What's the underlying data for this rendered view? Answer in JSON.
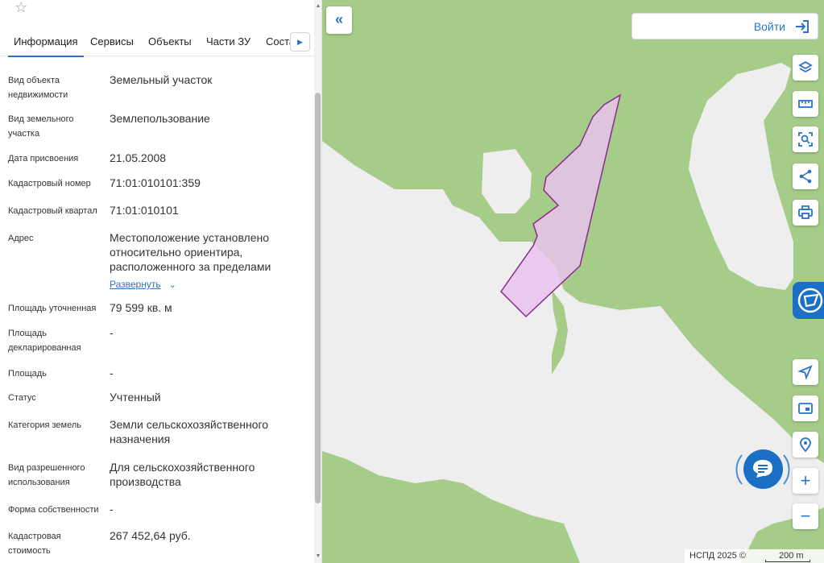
{
  "panel": {
    "favorite_icon": "star-icon",
    "tabs": [
      {
        "label": "Информация",
        "active": true
      },
      {
        "label": "Сервисы",
        "active": false
      },
      {
        "label": "Объекты",
        "active": false
      },
      {
        "label": "Части ЗУ",
        "active": false
      },
      {
        "label": "Соста",
        "active": false
      }
    ],
    "tab_next_icon": "chevron-right-icon",
    "rows": [
      {
        "label": "Вид объекта недвижимости",
        "value": "Земельный участок"
      },
      {
        "label": "Вид земельного участка",
        "value": "Землепользование"
      },
      {
        "label": "Дата присвоения",
        "value": "21.05.2008"
      },
      {
        "label": "Кадастровый номер",
        "value": "71:01:010101:359"
      },
      {
        "label": "Кадастровый квартал",
        "value": "71:01:010101"
      },
      {
        "label": "Адрес",
        "value": "Местоположение установлено относительно ориентира, расположенного за пределами",
        "expand_label": "Развернуть"
      },
      {
        "label": "Площадь уточненная",
        "value": "79 599 кв. м"
      },
      {
        "label": "Площадь декларированная",
        "value": "-"
      },
      {
        "label": "Площадь",
        "value": "-"
      },
      {
        "label": "Статус",
        "value": "Учтенный"
      },
      {
        "label": "Категория земель",
        "value": "Земли сельскохозяйственного назначения"
      },
      {
        "label": "Вид разрешенного использования",
        "value": "Для сельскохозяйственного производства"
      },
      {
        "label": "Форма собственности",
        "value": "-"
      },
      {
        "label": "Кадастровая стоимость",
        "value": "267 452,64 руб."
      }
    ]
  },
  "map": {
    "collapse_icon": "double-chevron-left-icon",
    "login_label": "Войти",
    "login_icon": "login-arrow-icon",
    "tools": [
      "layers-icon",
      "ruler-icon",
      "area-select-icon",
      "share-icon",
      "print-icon",
      "locate-icon",
      "minimap-icon",
      "location-pin-icon"
    ],
    "side_tab_icon": "panel-logo-icon",
    "chat_icon": "chat-icon",
    "zoom_in": "+",
    "zoom_out": "−",
    "attribution": "НСПД 2025 ©",
    "scale_label": "200 m",
    "colors": {
      "vegetation": "#a5cc88",
      "background": "#eeeeee",
      "parcel_fill": "#e8c2ec",
      "parcel_stroke": "#8b2a8e",
      "accent": "#1b6fc4"
    }
  }
}
